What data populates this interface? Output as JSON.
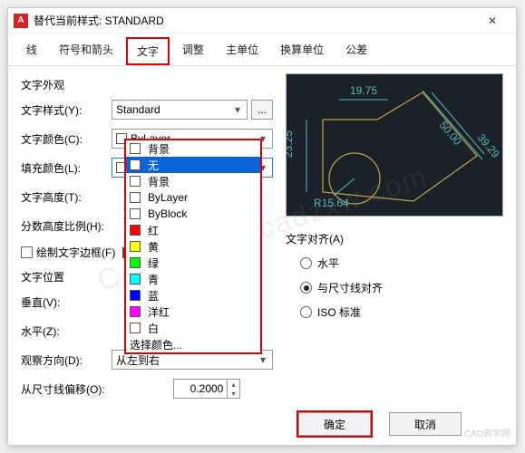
{
  "title": "替代当前样式: STANDARD",
  "tabs": {
    "line": "线",
    "symbols": "符号和箭头",
    "text": "文字",
    "adjust": "调整",
    "primary": "主单位",
    "alt": "换算单位",
    "tol": "公差"
  },
  "appearance": {
    "title": "文字外观",
    "style_label": "文字样式(Y):",
    "style_value": "Standard",
    "color_label": "文字颜色(C):",
    "color_value": "ByLayer",
    "fill_label": "填充颜色(L):",
    "fill_value": "背景",
    "height_label": "文字高度(T):",
    "fraction_label": "分数高度比例(H):",
    "frame_label": "绘制文字边框(F)"
  },
  "dropdown": {
    "items": [
      {
        "label": "背景",
        "swatch": "#fff"
      },
      {
        "label": "无",
        "swatch": "#fff",
        "selected": true
      },
      {
        "label": "背景",
        "swatch": "#fff"
      },
      {
        "label": "ByLayer",
        "swatch": "#fff"
      },
      {
        "label": "ByBlock",
        "swatch": "#fff"
      },
      {
        "label": "红",
        "swatch": "#f00"
      },
      {
        "label": "黄",
        "swatch": "#ff0"
      },
      {
        "label": "绿",
        "swatch": "#0f0"
      },
      {
        "label": "青",
        "swatch": "#0ff"
      },
      {
        "label": "蓝",
        "swatch": "#00f"
      },
      {
        "label": "洋红",
        "swatch": "#f0f"
      },
      {
        "label": "白",
        "swatch": "#fff"
      },
      {
        "label": "选择颜色...",
        "swatch": null
      }
    ]
  },
  "placement": {
    "title": "文字位置",
    "vert_label": "垂直(V):",
    "horz_label": "水平(Z):",
    "view_label": "观察方向(D):",
    "view_value": "从左到右",
    "offset_label": "从尺寸线偏移(O):",
    "offset_value": "0.2000"
  },
  "align": {
    "title": "文字对齐(A)",
    "horizontal": "水平",
    "withdim": "与尺寸线对齐",
    "iso": "ISO 标准"
  },
  "preview": {
    "dim_top": "19.75",
    "dim_left": "23.25",
    "dim_diag": "50.00",
    "dim_right": "39.29",
    "dim_rad": "R15.64"
  },
  "buttons": {
    "ok": "确定",
    "cancel": "取消"
  }
}
